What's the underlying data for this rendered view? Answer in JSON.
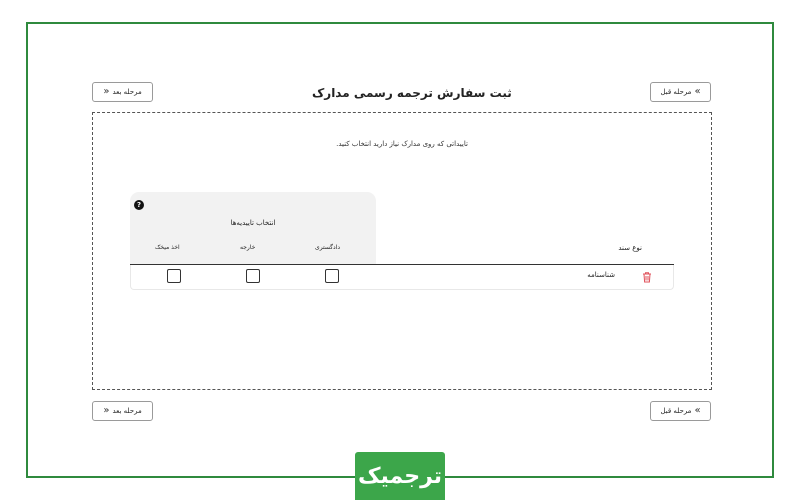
{
  "page": {
    "title": "ثبت سفارش ترجمه رسمی مدارک",
    "flag": "uk-flag"
  },
  "nav": {
    "next_label": "مرحله بعد",
    "prev_label": "مرحله قبل"
  },
  "instruction": "تاییداتی که روی مدارک نیاز دارید انتخاب کنید.",
  "confirmations": {
    "title": "انتخاب تاییدیه‌ها",
    "help": "?",
    "columns": [
      "اخذ میخک",
      "خارجه",
      "دادگستری"
    ]
  },
  "table": {
    "doc_type_header": "نوع سند",
    "rows": [
      {
        "name": "شناسنامه",
        "checked": [
          false,
          false,
          false
        ]
      }
    ]
  },
  "colors": {
    "frame": "#2f8a3e",
    "logo_bg": "#3ca64a",
    "trash": "#e0505a"
  },
  "logo_text": "ترجمیک"
}
